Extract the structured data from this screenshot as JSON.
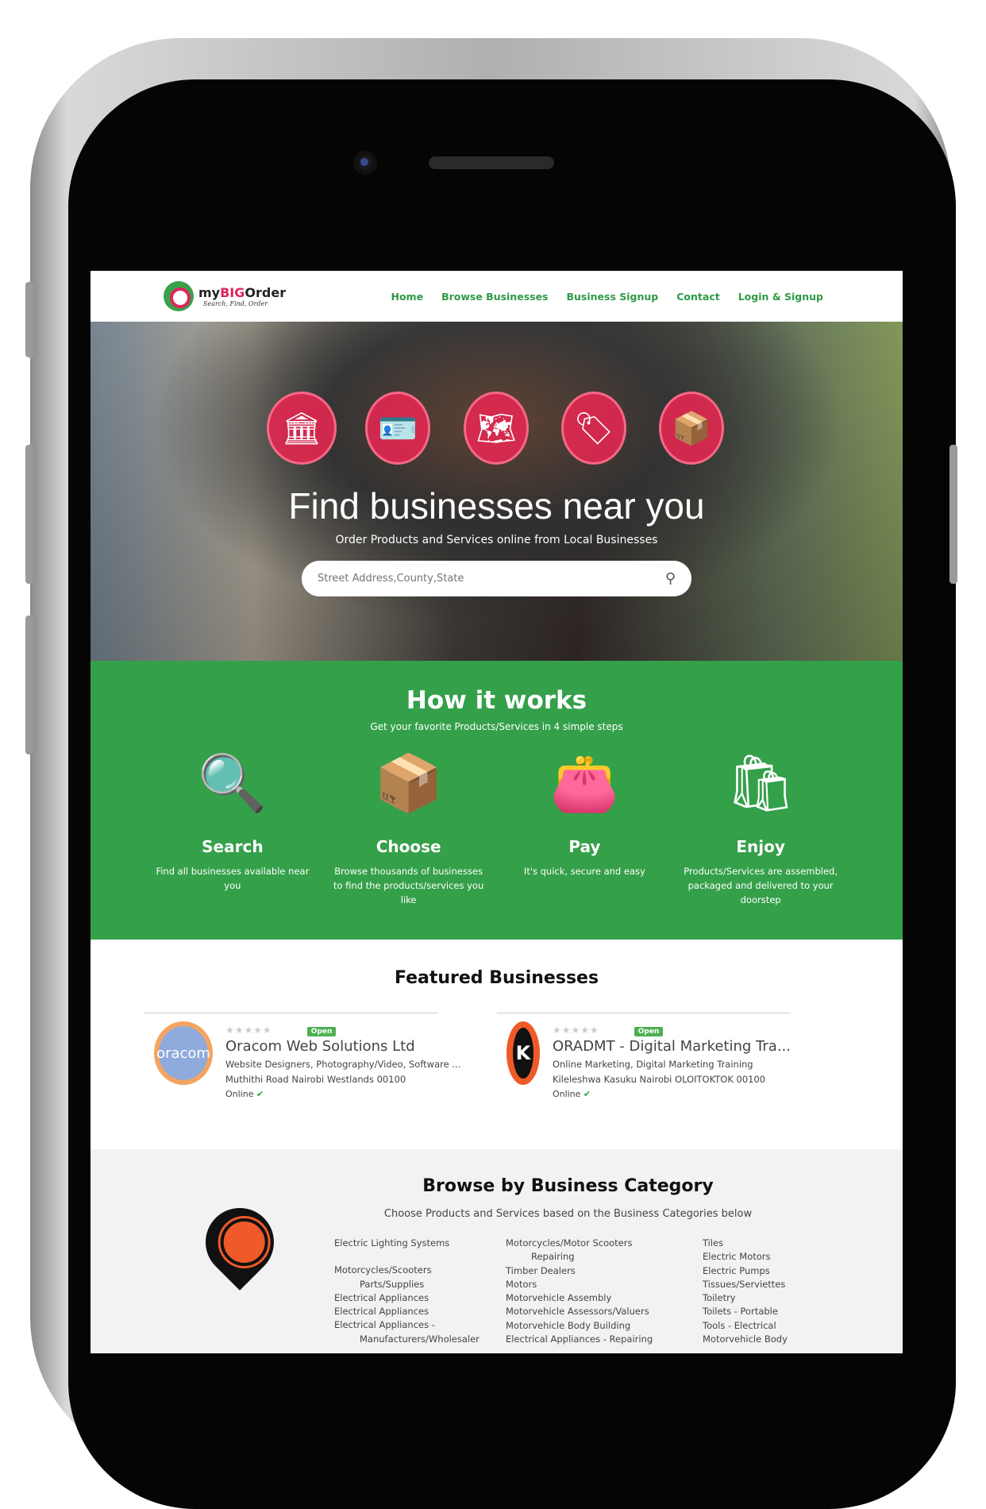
{
  "header": {
    "logo_text_pre": "my",
    "logo_text_big": "BIG",
    "logo_text_post": "Order",
    "logo_tagline": "Search, Find, Order",
    "nav": [
      "Home",
      "Browse Businesses",
      "Business Signup",
      "Contact",
      "Login & Signup"
    ]
  },
  "hero": {
    "title": "Find businesses near you",
    "subtitle": "Order Products and Services online from Local Businesses",
    "search_placeholder": "Street Address,County,State"
  },
  "how": {
    "title": "How it works",
    "subtitle": "Get your favorite Products/Services in 4 simple steps",
    "steps": [
      {
        "title": "Search",
        "text": "Find all businesses available near you"
      },
      {
        "title": "Choose",
        "text": "Browse thousands of businesses to find the products/services you like"
      },
      {
        "title": "Pay",
        "text": "It's quick, secure and easy"
      },
      {
        "title": "Enjoy",
        "text": "Products/Services are assembled, packaged and delivered to your doorstep"
      }
    ]
  },
  "featured": {
    "title": "Featured Businesses",
    "businesses": [
      {
        "name": "Oracom Web Solutions Ltd",
        "logo": "oracom",
        "badge": "Open",
        "categories": "Website Designers, Photography/Video, Software ...",
        "address": "Muthithi Road Nairobi Westlands 00100",
        "status": "Online",
        "rating": 0
      },
      {
        "name": "ORADMT - Digital Marketing Tra...",
        "logo": "K",
        "badge": "Open",
        "categories": "Online Marketing, Digital Marketing Training",
        "address": "Kileleshwa Kasuku Nairobi OLOITOKTOK 00100",
        "status": "Online",
        "rating": 0
      }
    ]
  },
  "categories": {
    "title": "Browse by Business Category",
    "subtitle": "Choose Products and Services based on the Business Categories below",
    "col1": [
      "Electric Lighting Systems",
      "",
      "Motorcycles/Scooters Parts/Supplies",
      "Electrical Appliances",
      "Electrical Appliances",
      "Electrical Appliances - Manufacturers/Wholesaler"
    ],
    "col2": [
      "Motorcycles/Motor Scooters Repairing",
      "Timber Dealers",
      "Motors",
      "Motorvehicle Assembly",
      "Motorvehicle Assessors/Valuers",
      "Motorvehicle Body Building",
      "Electrical Appliances - Repairing"
    ],
    "col3": [
      "Tiles",
      "Electric Motors",
      "Electric Pumps",
      "Tissues/Serviettes",
      "Toiletry",
      "Toilets - Portable",
      "Tools - Electrical",
      "Motorvehicle Body"
    ]
  }
}
